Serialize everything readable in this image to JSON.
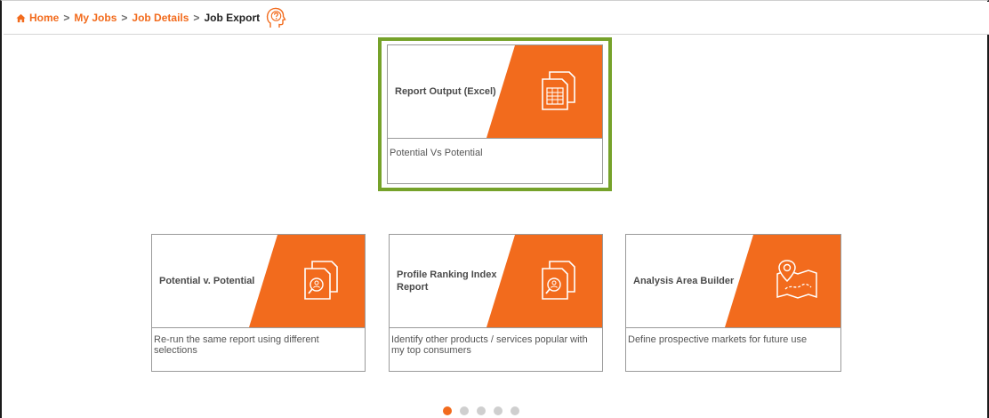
{
  "breadcrumb": {
    "items": [
      {
        "label": "Home"
      },
      {
        "label": "My Jobs"
      },
      {
        "label": "Job Details"
      }
    ],
    "separator": ">",
    "current": "Job Export",
    "home_icon": "home-icon",
    "help_icon": "help-head-icon"
  },
  "featured_card": {
    "title": "Report Output (Excel)",
    "description": "Potential Vs Potential",
    "icon": "excel-document-icon",
    "selected": true
  },
  "cards": [
    {
      "title": "Potential v. Potential",
      "description": "Re-run the same report using different selections",
      "icon": "document-search-icon"
    },
    {
      "title": "Profile Ranking Index Report",
      "description": "Identify other products / services popular with my top consumers",
      "icon": "document-search-icon"
    },
    {
      "title": "Analysis Area Builder",
      "description": "Define prospective markets for future use",
      "icon": "map-pin-icon"
    }
  ],
  "pagination": {
    "total": 5,
    "active_index": 0
  },
  "colors": {
    "accent": "#f26b1d",
    "selection": "#76a22a",
    "card_border": "#9a9a9a"
  }
}
